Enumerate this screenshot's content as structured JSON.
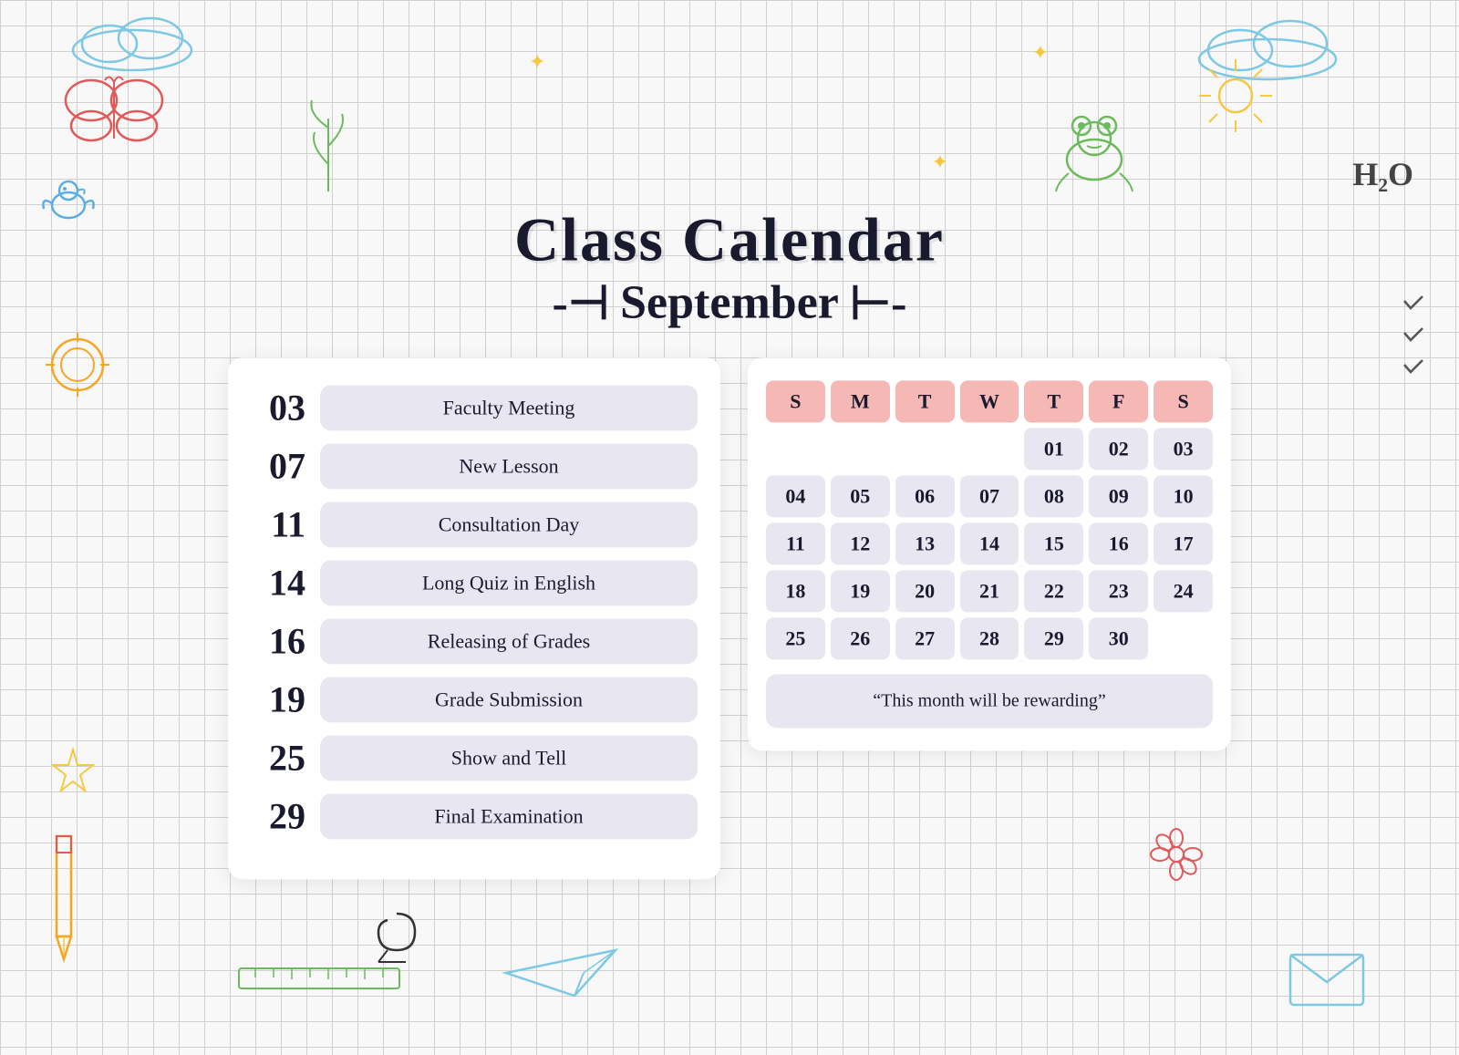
{
  "title": {
    "main": "Class Calendar",
    "month": "September",
    "arrow_left": "⊣",
    "arrow_right": "⊢"
  },
  "events": [
    {
      "date": "03",
      "label": "Faculty Meeting"
    },
    {
      "date": "07",
      "label": "New Lesson"
    },
    {
      "date": "11",
      "label": "Consultation Day"
    },
    {
      "date": "14",
      "label": "Long Quiz in English"
    },
    {
      "date": "16",
      "label": "Releasing of Grades"
    },
    {
      "date": "19",
      "label": "Grade Submission"
    },
    {
      "date": "25",
      "label": "Show and Tell"
    },
    {
      "date": "29",
      "label": "Final Examination"
    }
  ],
  "calendar": {
    "headers": [
      "S",
      "M",
      "T",
      "W",
      "T",
      "F",
      "S"
    ],
    "weeks": [
      [
        "",
        "",
        "",
        "",
        "01",
        "02",
        "03"
      ],
      [
        "04",
        "05",
        "06",
        "07",
        "08",
        "09",
        "10"
      ],
      [
        "11",
        "12",
        "13",
        "14",
        "15",
        "16",
        "17"
      ],
      [
        "18",
        "19",
        "20",
        "21",
        "22",
        "23",
        "24"
      ],
      [
        "25",
        "26",
        "27",
        "28",
        "29",
        "30",
        ""
      ]
    ]
  },
  "quote": "“This month will be rewarding”",
  "h2o": "H₂O",
  "sparkle": "✦"
}
